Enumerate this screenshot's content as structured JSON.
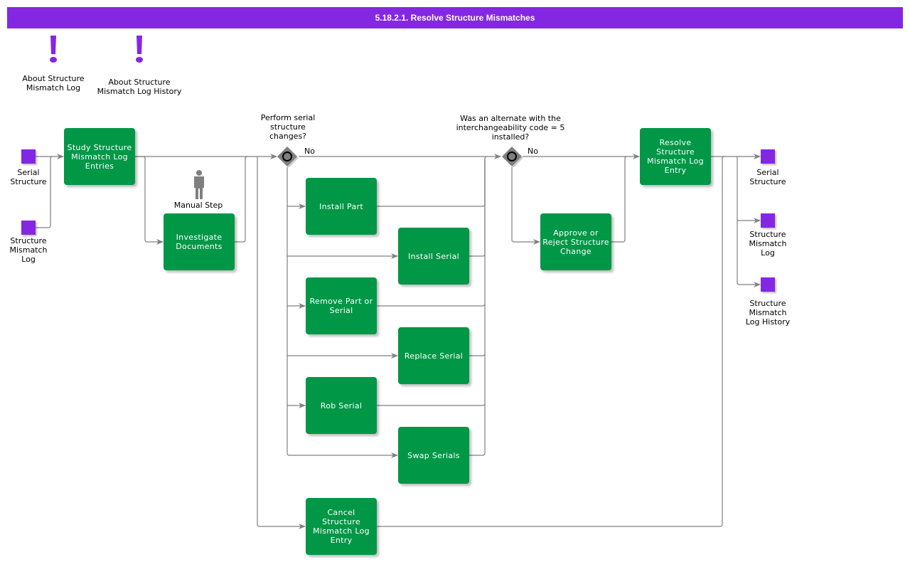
{
  "title": "5.18.2.1. Resolve Structure Mismatches",
  "colors": {
    "header": "#8427e2",
    "task": "#009747",
    "data_object": "#8427e2",
    "gateway": "#7f7f7f",
    "connector": "#7f7f7f"
  },
  "annotations": [
    {
      "icon": "exclamation-icon",
      "label": "About Structure\nMismatch Log"
    },
    {
      "icon": "exclamation-icon",
      "label": "About Structure\nMismatch Log History"
    }
  ],
  "inputs": [
    {
      "label": "Serial\nStructure"
    },
    {
      "label": "Structure\nMismatch\nLog"
    }
  ],
  "outputs": [
    {
      "label": "Serial\nStructure"
    },
    {
      "label": "Structure\nMismatch\nLog"
    },
    {
      "label": "Structure\nMismatch\nLog History"
    }
  ],
  "manual_step": {
    "icon": "person-icon",
    "label": "Manual Step"
  },
  "tasks": {
    "study": "Study Structure Mismatch Log Entries",
    "investigate": "Investigate Documents",
    "install_part": "Install Part",
    "install_serial": "Install Serial",
    "remove": "Remove Part or Serial",
    "replace": "Replace Serial",
    "rob": "Rob Serial",
    "swap": "Swap Serials",
    "cancel": "Cancel Structure Mismatch Log Entry",
    "approve": "Approve or Reject Structure Change",
    "resolve": "Resolve Structure Mismatch Log Entry"
  },
  "gateways": [
    {
      "question": "Perform serial\nstructure\nchanges?",
      "branch_label": "No"
    },
    {
      "question": "Was an alternate with the\ninterchangeability code = 5\ninstalled?",
      "branch_label": "No"
    }
  ]
}
